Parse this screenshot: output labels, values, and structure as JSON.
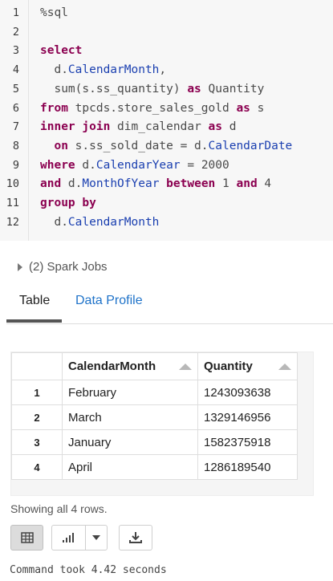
{
  "editor": {
    "line_numbers": [
      "1",
      "2",
      "3",
      "4",
      "5",
      "6",
      "7",
      "8",
      "9",
      "10",
      "11",
      "12"
    ],
    "lines": [
      [
        {
          "t": "%sql",
          "c": "plain"
        }
      ],
      [],
      [
        {
          "t": "select",
          "c": "kw"
        }
      ],
      [
        {
          "t": "  d.",
          "c": "plain"
        },
        {
          "t": "CalendarMonth",
          "c": "id"
        },
        {
          "t": ",",
          "c": "plain"
        }
      ],
      [
        {
          "t": "  sum(s.ss_quantity) ",
          "c": "plain"
        },
        {
          "t": "as",
          "c": "kw"
        },
        {
          "t": " Quantity",
          "c": "plain"
        }
      ],
      [
        {
          "t": "from",
          "c": "kw"
        },
        {
          "t": " tpcds.store_sales_gold ",
          "c": "plain"
        },
        {
          "t": "as",
          "c": "kw"
        },
        {
          "t": " s",
          "c": "plain"
        }
      ],
      [
        {
          "t": "inner join",
          "c": "kw"
        },
        {
          "t": " dim_calendar ",
          "c": "plain"
        },
        {
          "t": "as",
          "c": "kw"
        },
        {
          "t": " d",
          "c": "plain"
        }
      ],
      [
        {
          "t": "  on",
          "c": "kw"
        },
        {
          "t": " s.ss_sold_date = d.",
          "c": "plain"
        },
        {
          "t": "CalendarDate",
          "c": "id"
        }
      ],
      [
        {
          "t": "where",
          "c": "kw"
        },
        {
          "t": " d.",
          "c": "plain"
        },
        {
          "t": "CalendarYear",
          "c": "id"
        },
        {
          "t": " = 2000",
          "c": "plain"
        }
      ],
      [
        {
          "t": "and",
          "c": "kw"
        },
        {
          "t": " d.",
          "c": "plain"
        },
        {
          "t": "MonthOfYear",
          "c": "id"
        },
        {
          "t": " ",
          "c": "plain"
        },
        {
          "t": "between",
          "c": "kw"
        },
        {
          "t": " 1 ",
          "c": "plain"
        },
        {
          "t": "and",
          "c": "kw"
        },
        {
          "t": " 4",
          "c": "plain"
        }
      ],
      [
        {
          "t": "group by",
          "c": "kw"
        }
      ],
      [
        {
          "t": "  d.",
          "c": "plain"
        },
        {
          "t": "CalendarMonth",
          "c": "id"
        }
      ]
    ]
  },
  "spark_jobs": {
    "label": "(2) Spark Jobs"
  },
  "tabs": {
    "table": "Table",
    "data_profile": "Data Profile"
  },
  "table": {
    "headers": [
      "CalendarMonth",
      "Quantity"
    ],
    "rows": [
      {
        "idx": "1",
        "month": "February",
        "quantity": "1243093638"
      },
      {
        "idx": "2",
        "month": "March",
        "quantity": "1329146956"
      },
      {
        "idx": "3",
        "month": "January",
        "quantity": "1582375918"
      },
      {
        "idx": "4",
        "month": "April",
        "quantity": "1286189540"
      }
    ]
  },
  "status": "Showing all 4 rows.",
  "toolbar": {
    "table_icon": "table-grid-icon",
    "chart_icon": "bar-chart-icon",
    "dropdown_icon": "caret-down-icon",
    "download_icon": "download-icon"
  },
  "command_time": "Command took 4.42 seconds"
}
